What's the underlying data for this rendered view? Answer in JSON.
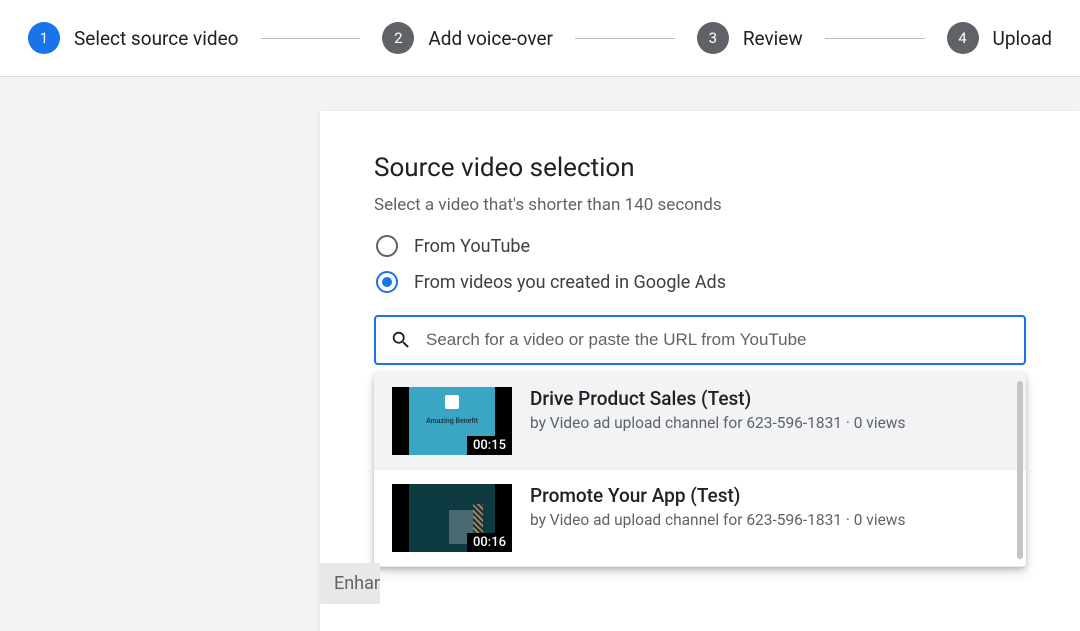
{
  "stepper": {
    "steps": [
      {
        "num": "1",
        "label": "Select source video",
        "active": true
      },
      {
        "num": "2",
        "label": "Add voice-over",
        "active": false
      },
      {
        "num": "3",
        "label": "Review",
        "active": false
      },
      {
        "num": "4",
        "label": "Upload",
        "active": false
      }
    ]
  },
  "card": {
    "title": "Source video selection",
    "subtitle": "Select a video that's shorter than 140 seconds",
    "radios": {
      "youtube": "From YouTube",
      "google_ads": "From videos you created in Google Ads"
    }
  },
  "search": {
    "placeholder": "Search for a video or paste the URL from YouTube",
    "value": ""
  },
  "results": [
    {
      "title": "Drive Product Sales (Test)",
      "byline": "by Video ad upload channel for 623-596-1831 · 0 views",
      "duration": "00:15",
      "thumb_text": "Amazing Benefit"
    },
    {
      "title": "Promote Your App (Test)",
      "byline": "by Video ad upload channel for 623-596-1831 · 0 views",
      "duration": "00:16",
      "thumb_text": ""
    }
  ],
  "bottom_chip": "Enhan"
}
